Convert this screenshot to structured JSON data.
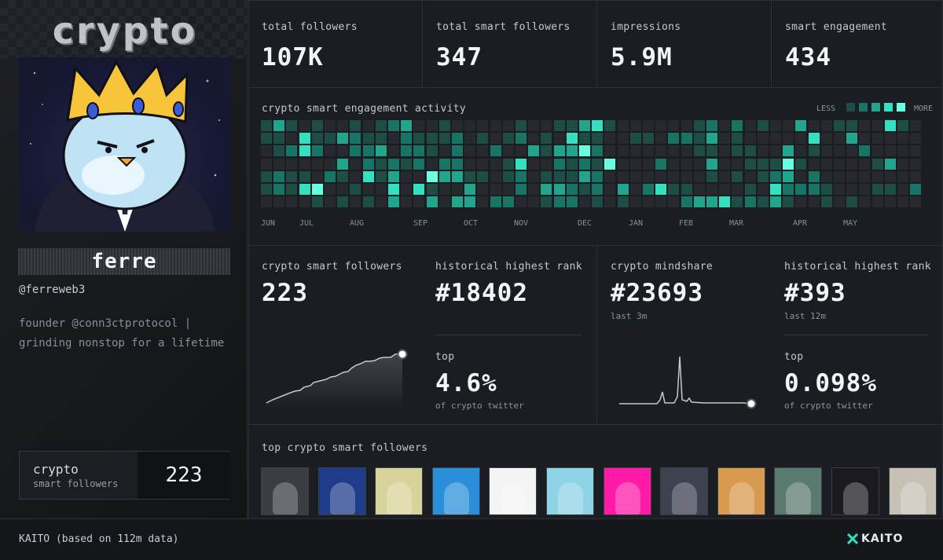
{
  "profile": {
    "banner_word": "crypto",
    "name": "ferre",
    "handle": "@ferreweb3",
    "bio_line1": "founder @conn3ctprotocol |",
    "bio_line2": "grinding nonstop for a lifetime",
    "box_label1": "crypto",
    "box_label2": "smart followers",
    "box_value": "223"
  },
  "stats": [
    {
      "label": "total followers",
      "value": "107K"
    },
    {
      "label": "total smart followers",
      "value": "347"
    },
    {
      "label": "impressions",
      "value": "5.9M"
    },
    {
      "label": "smart engagement",
      "value": "434"
    }
  ],
  "activity": {
    "title": "crypto smart engagement activity",
    "less": "LESS",
    "more": "MORE",
    "months": [
      "JUN",
      "JUL",
      "AUG",
      "SEP",
      "OCT",
      "NOV",
      "DEC",
      "JAN",
      "FEB",
      "MAR",
      "APR",
      "MAY"
    ]
  },
  "ranks": {
    "smart_followers_label": "crypto smart followers",
    "smart_followers_value": "223",
    "hist_rank_label": "historical highest rank",
    "hist_rank_value": "#18402",
    "top_label": "top",
    "top_value": "4.6%",
    "top_sub": "of crypto twitter",
    "mindshare_label": "crypto mindshare",
    "mindshare_value": "#23693",
    "mindshare_sub": "last 3m",
    "hist_rank2_label": "historical highest rank",
    "hist_rank2_value": "#393",
    "hist_rank2_sub": "last 12m",
    "top2_label": "top",
    "top2_value": "0.098%",
    "top2_sub": "of crypto twitter"
  },
  "followers": {
    "title": "top crypto smart followers",
    "items": [
      {
        "icon": "helmet-avatar-icon",
        "color": "#3a3d42"
      },
      {
        "icon": "blue-bird-avatar-icon",
        "color": "#1e3c8a"
      },
      {
        "icon": "ape-avatar-icon",
        "color": "#d8d39a"
      },
      {
        "icon": "cartoon-avatar-icon",
        "color": "#2a8fd8"
      },
      {
        "icon": "elisdefi-logo-icon",
        "color": "#f4f4f4"
      },
      {
        "icon": "robot-avatar-icon",
        "color": "#8fd3e6"
      },
      {
        "icon": "pixel-punk-avatar-icon",
        "color": "#ff1aa8"
      },
      {
        "icon": "penguin-avatar-icon",
        "color": "#3d4150"
      },
      {
        "icon": "man-photo-avatar-icon",
        "color": "#d79a4e"
      },
      {
        "icon": "pepe-avatar-icon",
        "color": "#5b7a6f"
      },
      {
        "icon": "hooded-avatar-icon",
        "color": "#1b1b1f"
      },
      {
        "icon": "dog-avatar-icon",
        "color": "#c7c0b4"
      }
    ]
  },
  "footer": {
    "source": "KAITO (based on 112m data)",
    "brand": "KAITO"
  }
}
